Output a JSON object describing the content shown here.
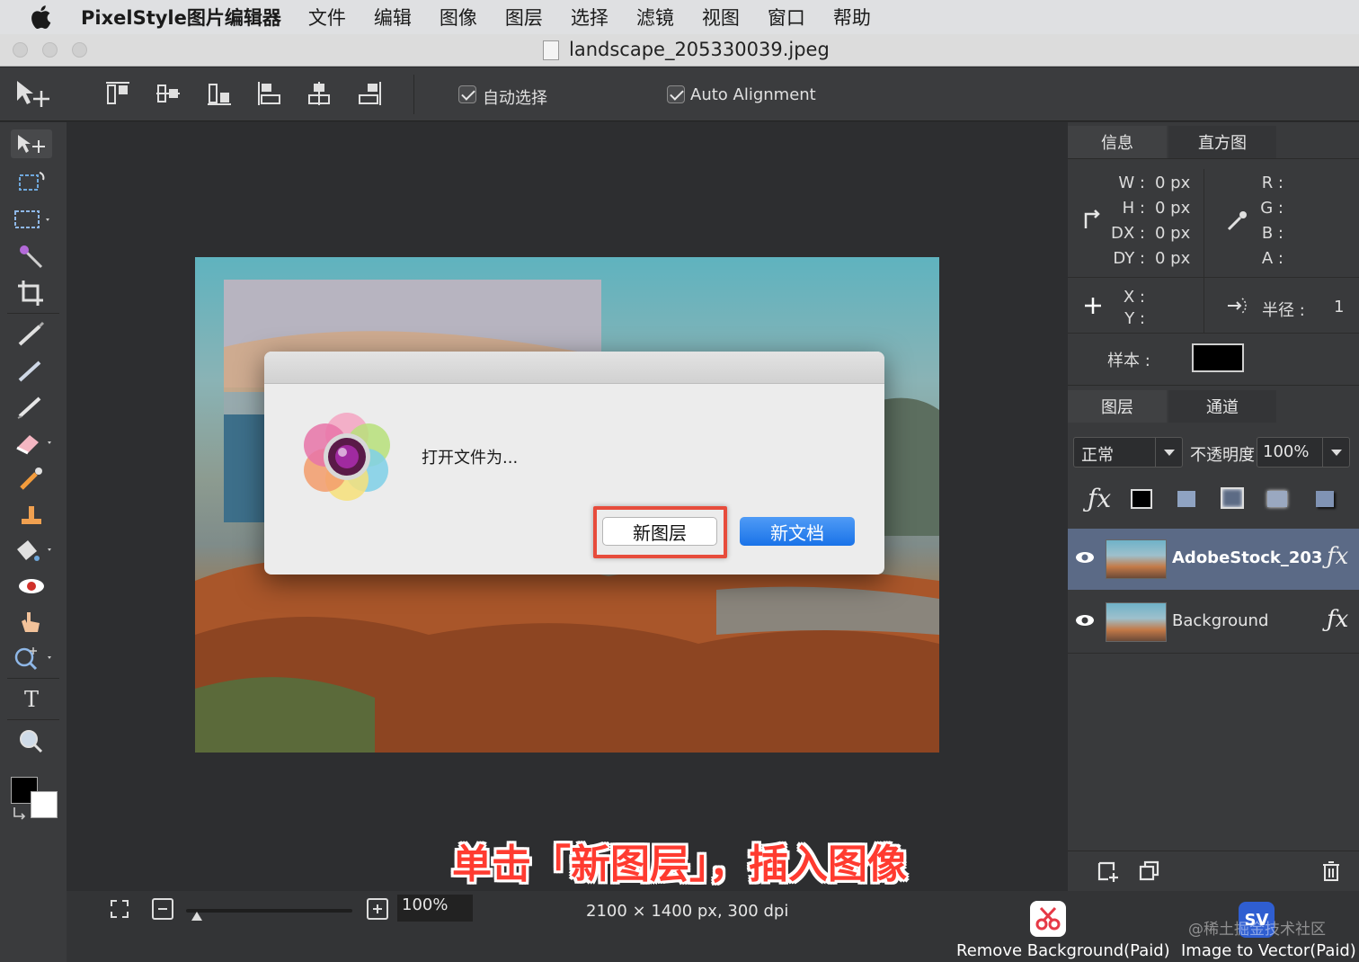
{
  "menubar": {
    "app_name": "PixelStyle图片编辑器",
    "items": [
      "文件",
      "编辑",
      "图像",
      "图层",
      "选择",
      "滤镜",
      "视图",
      "窗口",
      "帮助"
    ]
  },
  "window": {
    "title": "landscape_205330039.jpeg"
  },
  "options_bar": {
    "auto_select_label": "自动选择",
    "auto_alignment_label": "Auto Alignment"
  },
  "dialog": {
    "message": "打开文件为...",
    "new_layer_label": "新图层",
    "new_document_label": "新文档"
  },
  "info_panel": {
    "tabs": [
      "信息",
      "直方图"
    ],
    "size_labels": [
      "W :",
      "H :",
      "DX :",
      "DY :"
    ],
    "size_values": [
      "0 px",
      "0 px",
      "0 px",
      "0 px"
    ],
    "color_labels": [
      "R :",
      "G :",
      "B :",
      "A :"
    ],
    "pos_labels": [
      "X :",
      "Y :"
    ],
    "radius_label": "半径 :",
    "radius_value": "1",
    "sample_label": "样本 :",
    "sample_color": "#000000"
  },
  "layers_panel": {
    "tabs": [
      "图层",
      "通道"
    ],
    "blend_mode": "正常",
    "opacity_label": "不透明度",
    "opacity_value": "100%",
    "layers": [
      {
        "name": "AdobeStock_203",
        "selected": true
      },
      {
        "name": "Background",
        "selected": false
      }
    ]
  },
  "statusbar": {
    "zoom": "100%",
    "image_info": "2100 × 1400 px, 300 dpi",
    "remove_bg_label": "Remove Background(Paid)",
    "image_to_vector_label": "Image to Vector(Paid)"
  },
  "annotation": {
    "caption": "单击「新图层」，插入图像",
    "highlight_color": "#e74c3c"
  },
  "watermark": "@稀土掘金技术社区",
  "colors": {
    "accent_blue": "#1a73e8",
    "selected_layer_bg": "#5b6a86"
  }
}
